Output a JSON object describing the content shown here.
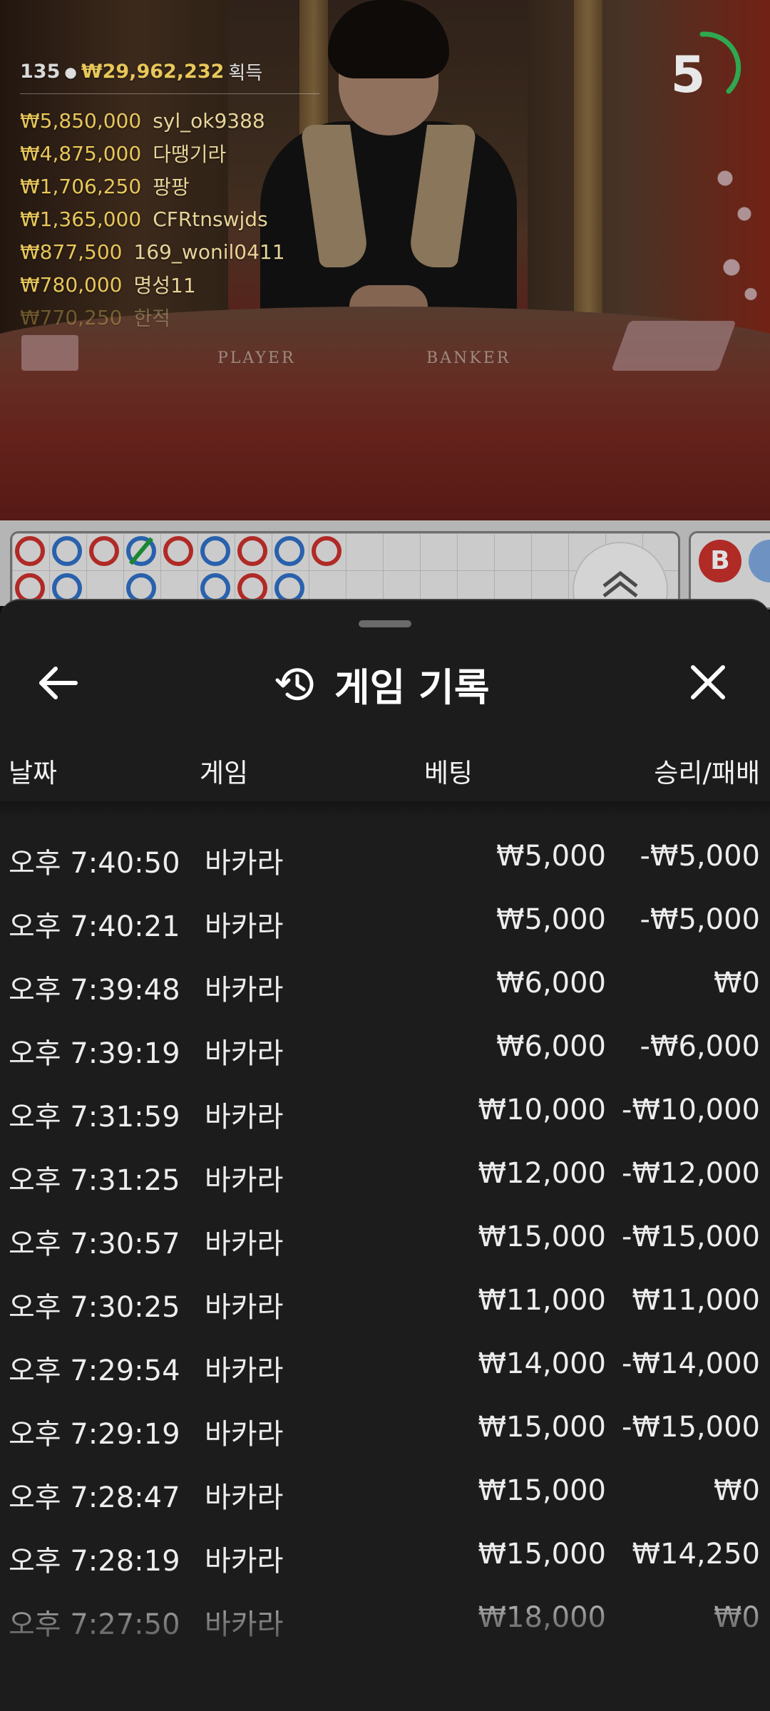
{
  "live": {
    "winners_summary": {
      "count": "135",
      "total": "₩29,962,232",
      "suffix": "획득"
    },
    "winners": [
      {
        "amount": "₩5,850,000",
        "name": "syl_ok9388"
      },
      {
        "amount": "₩4,875,000",
        "name": "다땡기라"
      },
      {
        "amount": "₩1,706,250",
        "name": "팡팡"
      },
      {
        "amount": "₩1,365,000",
        "name": "CFRtnswjds"
      },
      {
        "amount": "₩877,500",
        "name": "169_wonil0411"
      },
      {
        "amount": "₩780,000",
        "name": "명성11"
      },
      {
        "amount": "₩770,250",
        "name": "한적"
      }
    ],
    "countdown": "5",
    "table_labels": {
      "player": "PLAYER",
      "banker": "BANKER"
    }
  },
  "roadmap": {
    "bead_label": "B",
    "colors": {
      "banker": "#c9302c",
      "player": "#2f6fc4",
      "tie": "#1e9a3a"
    }
  },
  "history": {
    "title": "게임 기록",
    "columns": {
      "date": "날짜",
      "game": "게임",
      "bet": "베팅",
      "result": "승리/패배"
    },
    "rows": [
      {
        "time": "오후 7:40:50",
        "game": "바카라",
        "bet": "₩5,000",
        "result": "-₩5,000"
      },
      {
        "time": "오후 7:40:21",
        "game": "바카라",
        "bet": "₩5,000",
        "result": "-₩5,000"
      },
      {
        "time": "오후 7:39:48",
        "game": "바카라",
        "bet": "₩6,000",
        "result": "₩0"
      },
      {
        "time": "오후 7:39:19",
        "game": "바카라",
        "bet": "₩6,000",
        "result": "-₩6,000"
      },
      {
        "time": "오후 7:31:59",
        "game": "바카라",
        "bet": "₩10,000",
        "result": "-₩10,000"
      },
      {
        "time": "오후 7:31:25",
        "game": "바카라",
        "bet": "₩12,000",
        "result": "-₩12,000"
      },
      {
        "time": "오후 7:30:57",
        "game": "바카라",
        "bet": "₩15,000",
        "result": "-₩15,000"
      },
      {
        "time": "오후 7:30:25",
        "game": "바카라",
        "bet": "₩11,000",
        "result": "₩11,000"
      },
      {
        "time": "오후 7:29:54",
        "game": "바카라",
        "bet": "₩14,000",
        "result": "-₩14,000"
      },
      {
        "time": "오후 7:29:19",
        "game": "바카라",
        "bet": "₩15,000",
        "result": "-₩15,000"
      },
      {
        "time": "오후 7:28:47",
        "game": "바카라",
        "bet": "₩15,000",
        "result": "₩0"
      },
      {
        "time": "오후 7:28:19",
        "game": "바카라",
        "bet": "₩15,000",
        "result": "₩14,250"
      },
      {
        "time": "오후 7:27:50",
        "game": "바카라",
        "bet": "₩18,000",
        "result": "₩0"
      }
    ]
  }
}
